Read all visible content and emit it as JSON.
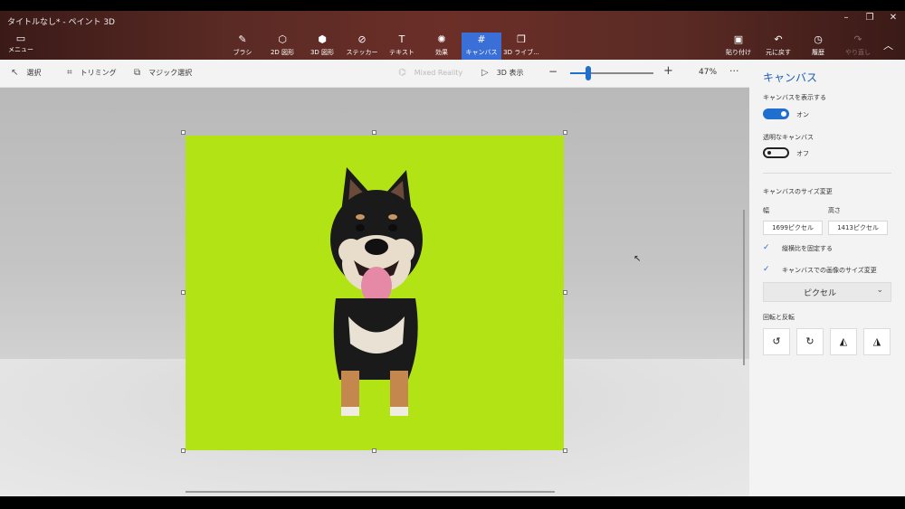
{
  "window": {
    "title": "タイトルなし* - ペイント 3D",
    "controls": [
      "–",
      "❐",
      "✕"
    ]
  },
  "ribbon": {
    "menu_label": "メニュー",
    "tools": [
      {
        "label": "ブラシ",
        "icon": "brush-icon",
        "glyph": "✎"
      },
      {
        "label": "2D 図形",
        "icon": "2d-shapes-icon",
        "glyph": "⬡"
      },
      {
        "label": "3D 図形",
        "icon": "3d-shapes-icon",
        "glyph": "⬢"
      },
      {
        "label": "ステッカー",
        "icon": "stickers-icon",
        "glyph": "⊘"
      },
      {
        "label": "テキスト",
        "icon": "text-icon",
        "glyph": "T"
      },
      {
        "label": "効果",
        "icon": "effects-icon",
        "glyph": "✺"
      },
      {
        "label": "キャンバス",
        "icon": "canvas-icon",
        "glyph": "#"
      },
      {
        "label": "3D ライブ...",
        "icon": "3d-library-icon",
        "glyph": "❒"
      }
    ],
    "active_tool": "キャンバス",
    "right_tools": [
      {
        "label": "貼り付け",
        "icon": "paste-icon",
        "glyph": "📋"
      },
      {
        "label": "元に戻す",
        "icon": "undo-icon",
        "glyph": "↶"
      },
      {
        "label": "履歴",
        "icon": "history-icon",
        "glyph": "◷"
      },
      {
        "label": "やり直し",
        "icon": "redo-icon",
        "glyph": "↷"
      }
    ]
  },
  "subbar": {
    "select_label": "選択",
    "crop_label": "トリミング",
    "magic_select_label": "マジック選択",
    "mixed_reality_label": "Mixed Reality",
    "view3d_label": "3D 表示",
    "zoom_value": "47%",
    "zoom_level": 0.2
  },
  "panel": {
    "title": "キャンバス",
    "show_canvas_label": "キャンバスを表示する",
    "show_canvas_state": "オン",
    "transparent_label": "透明なキャンバス",
    "transparent_state": "オフ",
    "resize_label": "キャンバスのサイズ変更",
    "width_label": "幅",
    "height_label": "高さ",
    "width_value": "1699ピクセル",
    "height_value": "1413ピクセル",
    "lock_aspect_label": "縦横比を固定する",
    "resize_image_label": "キャンバスでの画像のサイズ変更",
    "unit_value": "ピクセル",
    "rotate_label": "回転と反転"
  },
  "colors": {
    "accent": "#1f6fd0",
    "canvas_fill": "#b2e415",
    "ribbon": "#5a2a24"
  }
}
